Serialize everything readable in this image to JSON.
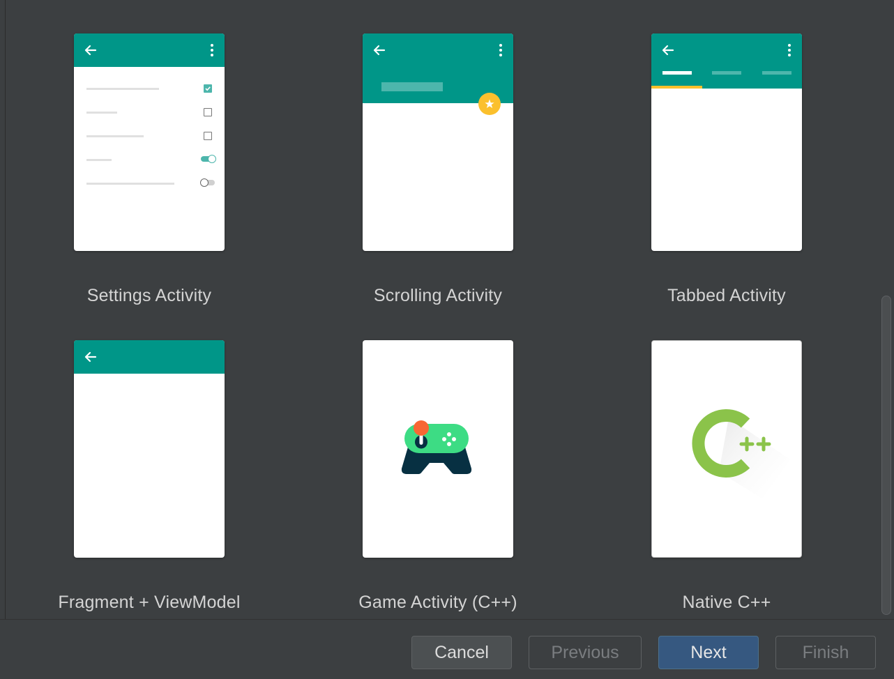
{
  "templates": [
    {
      "label": "Settings Activity"
    },
    {
      "label": "Scrolling Activity"
    },
    {
      "label": "Tabbed Activity"
    },
    {
      "label": "Fragment + ViewModel"
    },
    {
      "label": "Game Activity (C++)"
    },
    {
      "label": "Native C++"
    }
  ],
  "buttons": {
    "cancel": "Cancel",
    "previous": "Previous",
    "next": "Next",
    "finish": "Finish"
  },
  "colors": {
    "background": "#3c3f41",
    "appbar": "#009688",
    "accent_teal": "#4db6ac",
    "fab": "#fbc02d",
    "primary_button": "#365880",
    "cpp_green": "#8bc34a"
  },
  "icons": {
    "back": "back-arrow-icon",
    "overflow": "overflow-menu-icon",
    "fab": "star-icon",
    "game": "gamepad-icon",
    "cpp": "cpp-logo-icon"
  }
}
